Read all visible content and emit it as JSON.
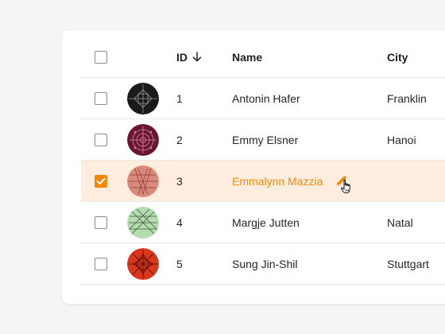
{
  "table": {
    "columns": {
      "id": "ID",
      "name": "Name",
      "city": "City"
    },
    "sort": {
      "column": "ID",
      "direction": "descending-arrow-down"
    },
    "rows": [
      {
        "id": "1",
        "name": "Antonin Hafer",
        "city": "Franklin",
        "selected": false,
        "avatar_color": "#1a1a1a"
      },
      {
        "id": "2",
        "name": "Emmy Elsner",
        "city": "Hanoi",
        "selected": false,
        "avatar_color": "#6b1530"
      },
      {
        "id": "3",
        "name": "Emmalynn Mazzia",
        "city": "",
        "selected": true,
        "avatar_color": "#d98a7a"
      },
      {
        "id": "4",
        "name": "Margje Jutten",
        "city": "Natal",
        "selected": false,
        "avatar_color": "#b5dcb0"
      },
      {
        "id": "5",
        "name": "Sung Jin-Shil",
        "city": "Stuttgart",
        "selected": false,
        "avatar_color": "#d9361c"
      }
    ]
  },
  "colors": {
    "accent": "#f5880a",
    "selected_row_bg": "#ffeee0",
    "page_bg": "#f5f5f5"
  },
  "icons": {
    "edit": "pencil-icon",
    "cursor": "hand-pointer-cursor-icon",
    "sort": "arrow-down-icon"
  }
}
